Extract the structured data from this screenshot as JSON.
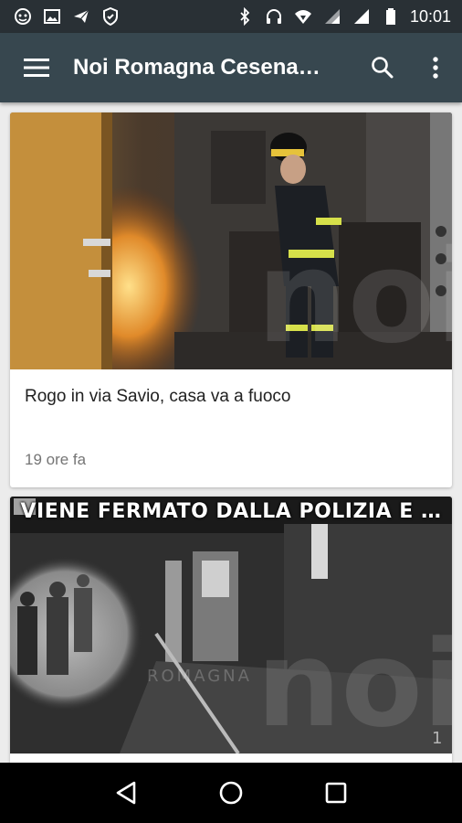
{
  "status_bar": {
    "time": "10:01",
    "left_icons": [
      "ghost-icon",
      "image-icon",
      "send-icon",
      "shield-icon"
    ],
    "right_icons": [
      "bluetooth-icon",
      "headphones-icon",
      "wifi-icon",
      "signal-icon",
      "signal-icon",
      "battery-icon"
    ]
  },
  "app_bar": {
    "title": "Noi Romagna Cesena…",
    "background": "#37474f"
  },
  "articles": [
    {
      "title": "Rogo in via Savio, casa va a fuoco",
      "time": "19 ore fa",
      "image_icon": "firefighter-photo"
    },
    {
      "overlay_text": "VIENE FERMATO DALLA POLIZIA E …",
      "watermark": "ROMAGNA",
      "image_icon": "night-street-photo"
    }
  ],
  "nav_bar": {
    "buttons": [
      "back-icon",
      "home-icon",
      "recents-icon"
    ]
  }
}
